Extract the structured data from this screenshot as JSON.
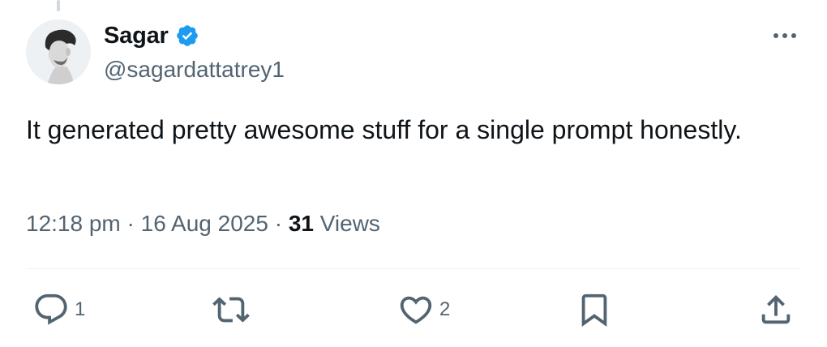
{
  "tweet": {
    "author": {
      "display_name": "Sagar",
      "handle": "@sagardattatrey1",
      "verified": true
    },
    "text": "It generated pretty awesome stuff for a single prompt honestly.",
    "time": "12:18 pm",
    "date": "16 Aug 2025",
    "separator": "·",
    "views_count": "31",
    "views_label": "Views"
  },
  "actions": {
    "reply_count": "1",
    "like_count": "2"
  },
  "icons": {
    "reply": "reply-icon",
    "retweet": "retweet-icon",
    "like": "heart-icon",
    "bookmark": "bookmark-icon",
    "share": "share-icon",
    "more": "more-icon",
    "verified": "verified-badge-icon"
  },
  "colors": {
    "text_primary": "#0f1419",
    "text_secondary": "#536471",
    "verified_blue": "#1d9bf0",
    "divider": "#eff3f4"
  }
}
